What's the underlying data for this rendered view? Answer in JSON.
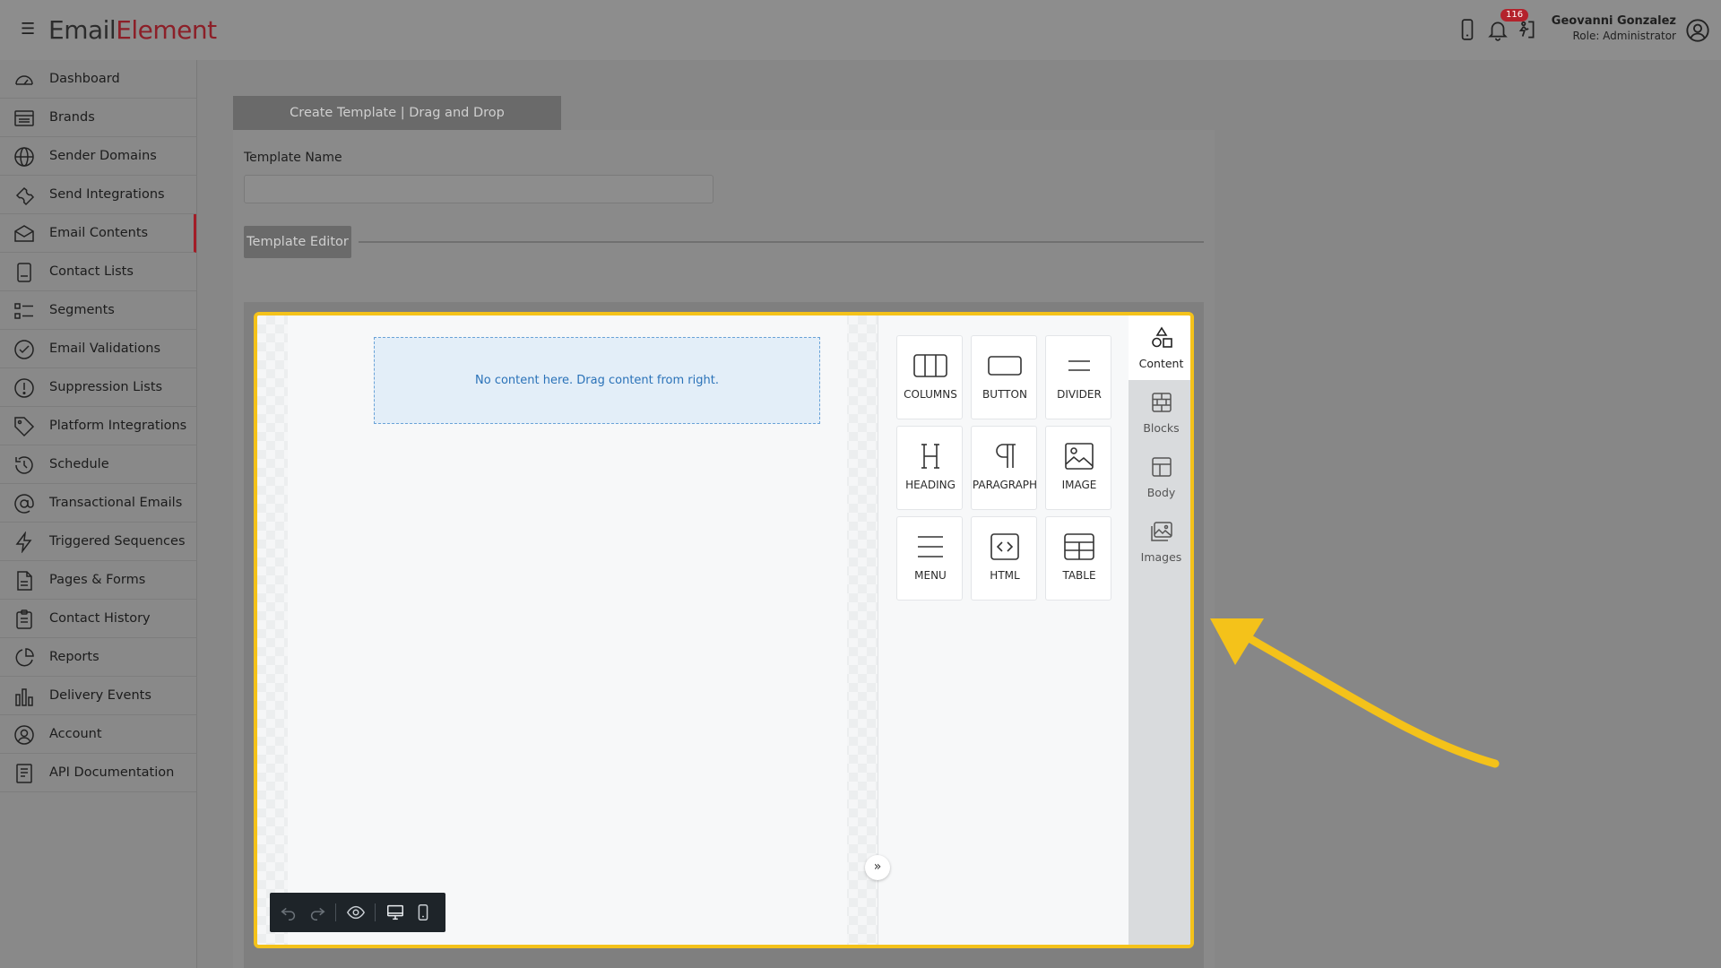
{
  "app": {
    "logo_part1": "Em",
    "logo_part2": "ail",
    "logo_part3": "Element"
  },
  "header": {
    "notification_count": "116",
    "user_name": "Geovanni Gonzalez",
    "user_role": "Role: Administrator",
    "icons": [
      "hamburger-icon",
      "mobile-phone-icon",
      "bell-icon",
      "exit-icon",
      "user-avatar-icon"
    ]
  },
  "sidebar": {
    "items": [
      {
        "label": "Dashboard",
        "icon": "gauge-icon"
      },
      {
        "label": "Brands",
        "icon": "list-icon"
      },
      {
        "label": "Sender Domains",
        "icon": "globe-icon"
      },
      {
        "label": "Send Integrations",
        "icon": "wrench-icon"
      },
      {
        "label": "Email Contents",
        "icon": "envelope-icon",
        "active": true
      },
      {
        "label": "Contact Lists",
        "icon": "book-icon"
      },
      {
        "label": "Segments",
        "icon": "segments-icon"
      },
      {
        "label": "Email Validations",
        "icon": "check-circle-icon"
      },
      {
        "label": "Suppression Lists",
        "icon": "exclamation-circle-icon"
      },
      {
        "label": "Platform Integrations",
        "icon": "tag-icon"
      },
      {
        "label": "Schedule",
        "icon": "history-icon"
      },
      {
        "label": "Transactional Emails",
        "icon": "at-icon"
      },
      {
        "label": "Triggered Sequences",
        "icon": "bolt-icon"
      },
      {
        "label": "Pages & Forms",
        "icon": "file-icon"
      },
      {
        "label": "Contact History",
        "icon": "clipboard-icon"
      },
      {
        "label": "Reports",
        "icon": "pie-chart-icon"
      },
      {
        "label": "Delivery Events",
        "icon": "bar-chart-icon"
      },
      {
        "label": "Account",
        "icon": "user-circle-icon"
      },
      {
        "label": "API Documentation",
        "icon": "document-icon"
      }
    ]
  },
  "main": {
    "tab_label": "Create Template | Drag and Drop",
    "template_name_label": "Template Name",
    "template_name_value": "",
    "template_editor_label": "Template Editor",
    "dropzone_text": "No content here. Drag content from right.",
    "content_tiles": [
      {
        "label": "COLUMNS",
        "icon": "columns-icon"
      },
      {
        "label": "BUTTON",
        "icon": "button-icon"
      },
      {
        "label": "DIVIDER",
        "icon": "divider-icon"
      },
      {
        "label": "HEADING",
        "icon": "heading-icon"
      },
      {
        "label": "PARAGRAPH",
        "icon": "paragraph-icon"
      },
      {
        "label": "IMAGE",
        "icon": "image-icon"
      },
      {
        "label": "MENU",
        "icon": "menu-icon"
      },
      {
        "label": "HTML",
        "icon": "html-icon"
      },
      {
        "label": "TABLE",
        "icon": "table-icon"
      }
    ],
    "side_tabs": [
      {
        "label": "Content",
        "icon": "shapes-icon",
        "active": true
      },
      {
        "label": "Blocks",
        "icon": "blocks-icon"
      },
      {
        "label": "Body",
        "icon": "layout-icon"
      },
      {
        "label": "Images",
        "icon": "images-icon"
      }
    ],
    "toolbar_icons": [
      "undo-icon",
      "redo-icon",
      "eye-icon",
      "desktop-icon",
      "mobile-icon"
    ],
    "highlight_color": "#f4c21a"
  }
}
